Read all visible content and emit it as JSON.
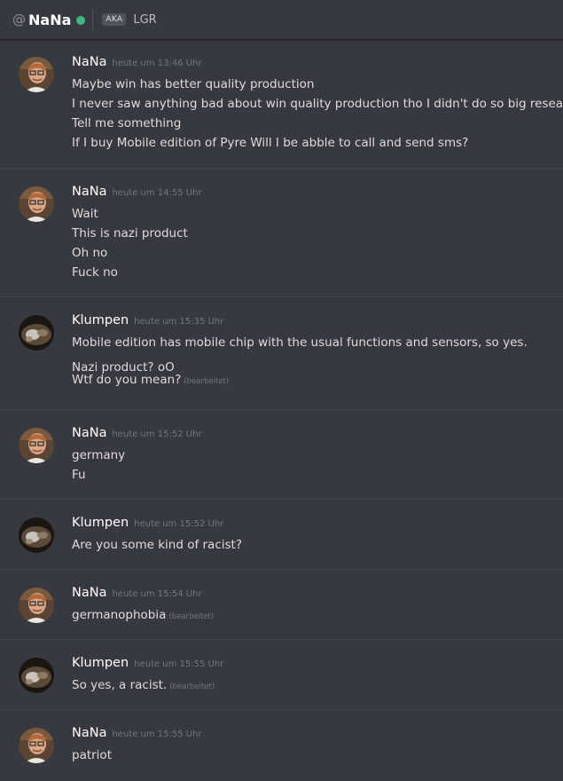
{
  "header": {
    "at_symbol": "@",
    "name": "NaNa",
    "status_color": "#43b581",
    "aka_badge": "AKA",
    "nickname": "LGR"
  },
  "edited_label": "(bearbeitet)",
  "messages": [
    {
      "author": "NaNa",
      "timestamp": "heute um 13:46 Uhr",
      "lines": [
        "Maybe win has better quality production",
        "I never saw anything bad about win quality production tho I didn't do so big research",
        "Tell me something",
        "If I buy Mobile edition of Pyre Will I be abble to call and send sms?"
      ]
    },
    {
      "author": "NaNa",
      "timestamp": "heute um 14:55 Uhr",
      "lines": [
        "Wait",
        "This is nazi product",
        "Oh no",
        "Fuck no"
      ]
    },
    {
      "author": "Klumpen",
      "timestamp": "heute um 15:35 Uhr",
      "lines": [
        "Mobile edition has mobile chip with the usual functions and sensors, so yes.",
        "Nazi product? oO",
        "Wtf do you mean?"
      ]
    },
    {
      "author": "NaNa",
      "timestamp": "heute um 15:52 Uhr",
      "lines": [
        "germany",
        "Fu"
      ]
    },
    {
      "author": "Klumpen",
      "timestamp": "heute um 15:52 Uhr",
      "lines": [
        "Are you some kind of racist?"
      ]
    },
    {
      "author": "NaNa",
      "timestamp": "heute um 15:54 Uhr",
      "lines": [
        "germanophobia"
      ]
    },
    {
      "author": "Klumpen",
      "timestamp": "heute um 15:55 Uhr",
      "lines": [
        "So yes, a racist."
      ]
    },
    {
      "author": "NaNa",
      "timestamp": "heute um 15:55 Uhr",
      "lines": [
        "patriot"
      ]
    }
  ]
}
